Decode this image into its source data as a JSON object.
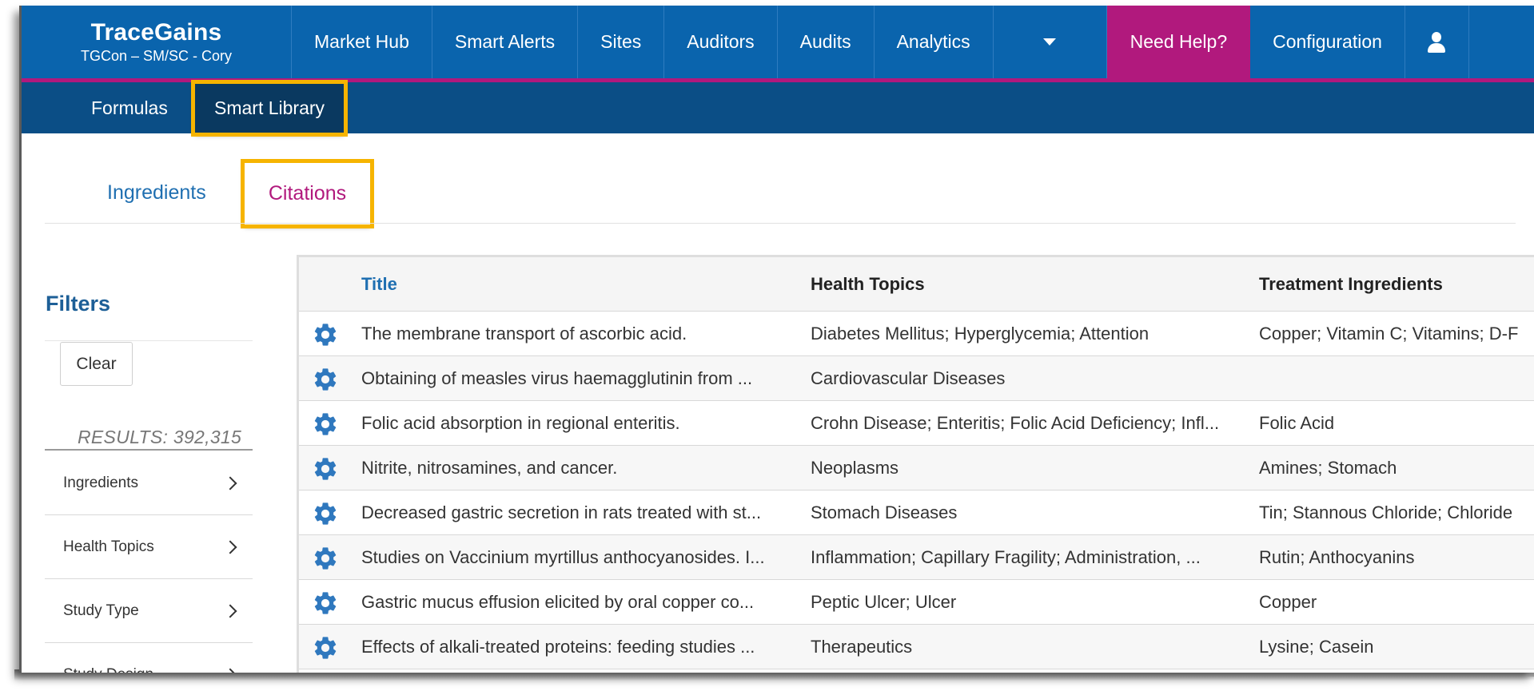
{
  "brand": {
    "name": "TraceGains",
    "account": "TGCon – SM/SC - Cory"
  },
  "topnav": {
    "items": [
      "Market Hub",
      "Smart Alerts",
      "Sites",
      "Auditors",
      "Audits",
      "Analytics"
    ],
    "help": "Need Help?",
    "configuration": "Configuration"
  },
  "subnav": {
    "items": [
      "Formulas",
      "Smart Library"
    ]
  },
  "tabs": [
    "Ingredients",
    "Citations"
  ],
  "filters": {
    "title": "Filters",
    "clear": "Clear",
    "results": "RESULTS: 392,315",
    "facets": [
      "Ingredients",
      "Health Topics",
      "Study Type",
      "Study Design"
    ]
  },
  "table": {
    "columns": [
      "Title",
      "Health Topics",
      "Treatment Ingredients"
    ],
    "rows": [
      [
        "The membrane transport of ascorbic acid.",
        "Diabetes Mellitus; Hyperglycemia; Attention",
        "Copper; Vitamin C; Vitamins; D-F"
      ],
      [
        "Obtaining of measles virus haemagglutinin from ...",
        "Cardiovascular Diseases",
        ""
      ],
      [
        "Folic acid absorption in regional enteritis.",
        "Crohn Disease; Enteritis; Folic Acid Deficiency; Infl...",
        "Folic Acid"
      ],
      [
        "Nitrite, nitrosamines, and cancer.",
        "Neoplasms",
        "Amines; Stomach"
      ],
      [
        "Decreased gastric secretion in rats treated with st...",
        "Stomach Diseases",
        "Tin; Stannous Chloride; Chloride"
      ],
      [
        "Studies on Vaccinium myrtillus anthocyanosides. I...",
        "Inflammation; Capillary Fragility; Administration, ...",
        "Rutin; Anthocyanins"
      ],
      [
        "Gastric mucus effusion elicited by oral copper co...",
        "Peptic Ulcer; Ulcer",
        "Copper"
      ],
      [
        "Effects of alkali-treated proteins: feeding studies ...",
        "Therapeutics",
        "Lysine; Casein"
      ]
    ]
  },
  "colors": {
    "nav_blue": "#0a64ad",
    "subnav_blue": "#0b4e86",
    "accent_magenta": "#b1197d",
    "highlight_gold": "#f6b400",
    "link_blue": "#1f6fb1"
  }
}
